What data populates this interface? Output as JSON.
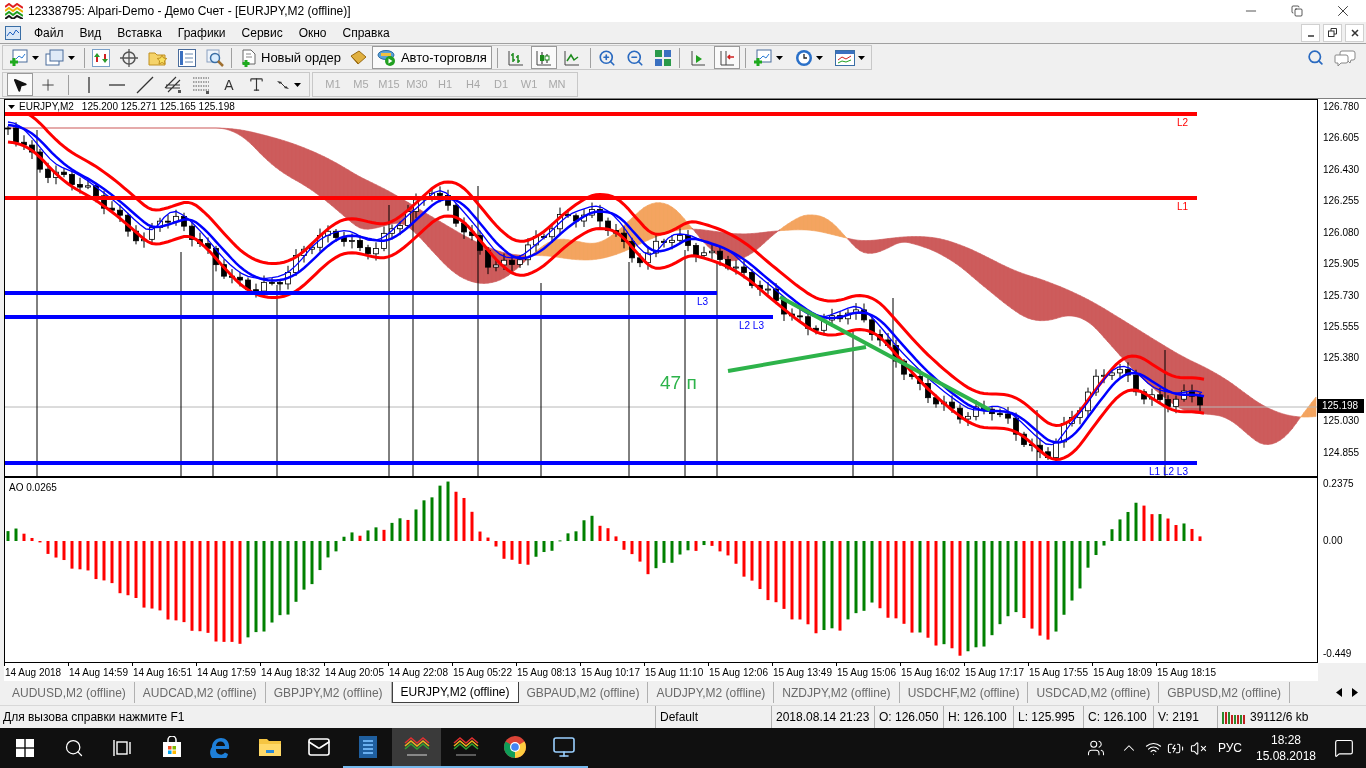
{
  "window": {
    "title": "12338795: Alpari-Demo - Демо Счет - [EURJPY,M2 (offline)]"
  },
  "menu": [
    "Файл",
    "Вид",
    "Вставка",
    "Графики",
    "Сервис",
    "Окно",
    "Справка"
  ],
  "toolbar": {
    "new_order": "Новый ордер",
    "autotrading": {
      "label": "Авто-торговля",
      "on": true
    },
    "chart_modes": [
      {
        "selected": false
      },
      {
        "selected": true
      },
      {
        "selected": false
      }
    ],
    "auto_scroll": {
      "on": false
    },
    "chart_shift": {
      "on": true
    }
  },
  "drawing_toolbar": {
    "cursor_modes": [
      {
        "selected": true
      },
      {
        "selected": false
      }
    ],
    "text_tool": "A",
    "timeframes": [
      {
        "label": "M1",
        "disabled": true
      },
      {
        "label": "M5",
        "disabled": true
      },
      {
        "label": "M15",
        "disabled": true
      },
      {
        "label": "M30",
        "disabled": true
      },
      {
        "label": "H1",
        "disabled": true
      },
      {
        "label": "H4",
        "disabled": true
      },
      {
        "label": "D1",
        "disabled": true
      },
      {
        "label": "W1",
        "disabled": true
      },
      {
        "label": "MN",
        "disabled": true
      }
    ]
  },
  "chart": {
    "symbol": "EURJPY,M2",
    "quote": "125.200 125.271 125.165 125.198",
    "price_scale": [
      "126.780",
      "126.605",
      "126.430",
      "126.255",
      "126.080",
      "125.905",
      "125.730",
      "125.555",
      "125.380",
      "125.030",
      "124.855"
    ],
    "current_price": "125.198",
    "levels": [
      {
        "label": "L2",
        "color": "#ff0000"
      },
      {
        "label": "L1",
        "color": "#ff0000"
      },
      {
        "label": "L3",
        "color": "#0000ff"
      },
      {
        "label": "L2 L3",
        "color": "#0000ff"
      },
      {
        "label": "L1 L2 L3",
        "color": "#0000ff"
      }
    ],
    "annotation": "47 п",
    "indicator": {
      "label": "AO 0.0265",
      "scale": [
        "0.2375",
        "0.00",
        "-0.449"
      ]
    },
    "time_scale": [
      "14 Aug 2018",
      "14 Aug 14:59",
      "14 Aug 16:51",
      "14 Aug 17:59",
      "14 Aug 18:32",
      "14 Aug 20:05",
      "14 Aug 22:08",
      "15 Aug 05:22",
      "15 Aug 08:13",
      "15 Aug 10:17",
      "15 Aug 11:10",
      "15 Aug 12:06",
      "15 Aug 13:49",
      "15 Aug 15:06",
      "15 Aug 16:02",
      "15 Aug 17:17",
      "15 Aug 17:55",
      "15 Aug 18:09",
      "15 Aug 18:15"
    ]
  },
  "tabs": [
    {
      "label": "AUDUSD,M2 (offline)",
      "selected": false
    },
    {
      "label": "AUDCAD,M2 (offline)",
      "selected": false
    },
    {
      "label": "GBPJPY,M2 (offline)",
      "selected": false
    },
    {
      "label": "EURJPY,M2 (offline)",
      "selected": true
    },
    {
      "label": "GBPAUD,M2 (offline)",
      "selected": false
    },
    {
      "label": "AUDJPY,M2 (offline)",
      "selected": false
    },
    {
      "label": "NZDJPY,M2 (offline)",
      "selected": false
    },
    {
      "label": "USDCHF,M2 (offline)",
      "selected": false
    },
    {
      "label": "USDCAD,M2 (offline)",
      "selected": false
    },
    {
      "label": "GBPUSD,M2 (offline)",
      "selected": false
    }
  ],
  "status_bar": {
    "help": "Для вызова справки нажмите F1",
    "profile": "Default",
    "datetime": "2018.08.14 21:23",
    "open": "O: 126.050",
    "high": "H: 126.100",
    "low": "L: 125.995",
    "close": "C: 126.100",
    "volume": "V: 2191",
    "traffic": "39112/6 kb"
  },
  "taskbar": {
    "apps": [
      {
        "running": false,
        "active": false
      },
      {
        "running": false,
        "active": false
      },
      {
        "running": false,
        "active": false
      },
      {
        "running": false,
        "active": false
      },
      {
        "running": true,
        "active": false
      },
      {
        "running": true,
        "active": true
      },
      {
        "running": true,
        "active": false
      },
      {
        "running": true,
        "active": false
      },
      {
        "running": true,
        "active": false
      }
    ],
    "language": "РУС",
    "time": "18:28",
    "date": "15.08.2018"
  }
}
